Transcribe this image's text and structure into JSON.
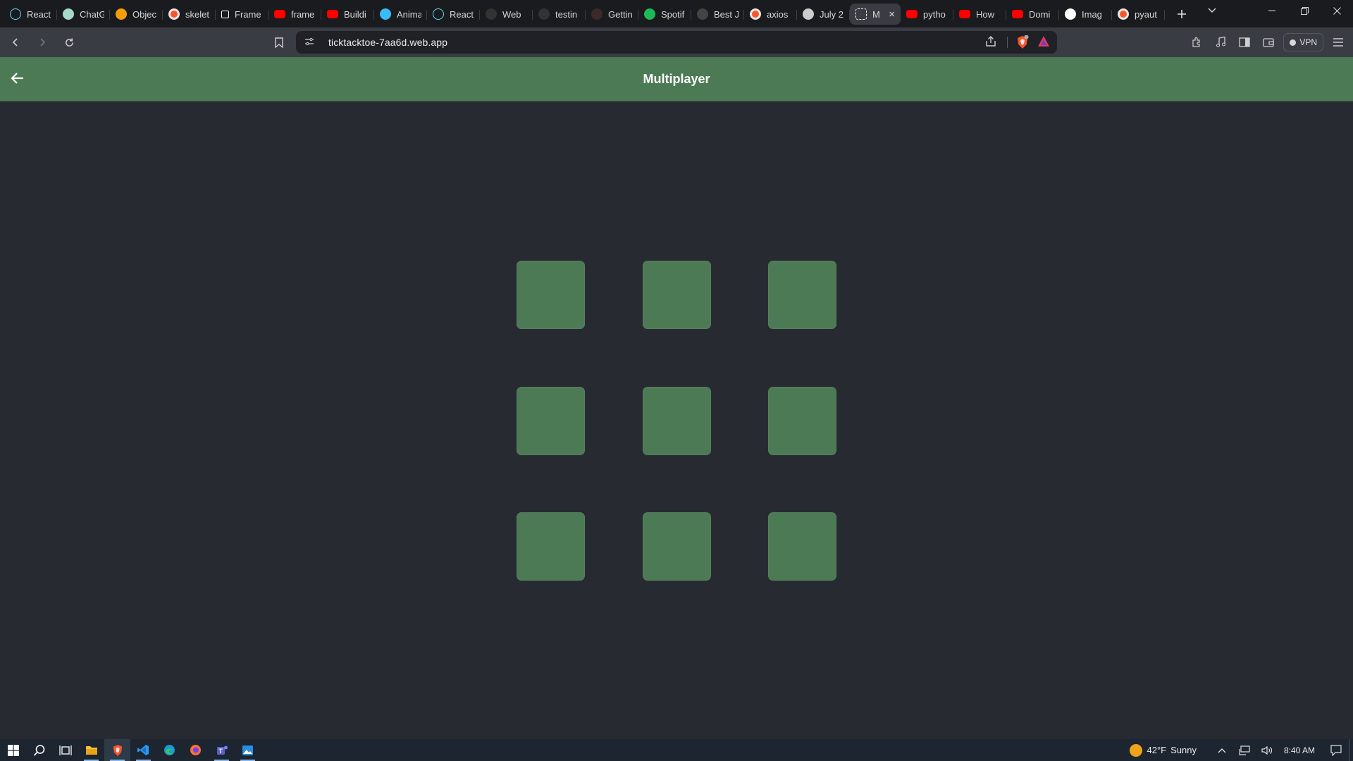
{
  "browser": {
    "tabs": [
      {
        "label": "React",
        "icon": "react-icon",
        "color": "#61dafb"
      },
      {
        "label": "ChatG",
        "icon": "chatgpt-icon",
        "color": "#a8d8c8"
      },
      {
        "label": "Objec",
        "icon": "pitchfork-icon",
        "color": "#f59e0b"
      },
      {
        "label": "skelet",
        "icon": "brave-search-icon",
        "color": "#e8e8e8"
      },
      {
        "label": "Frame",
        "icon": "framer-icon",
        "color": "#ffffff"
      },
      {
        "label": "frame",
        "icon": "youtube-icon",
        "color": "#ff0000"
      },
      {
        "label": "Buildi",
        "icon": "youtube-icon",
        "color": "#ff0000"
      },
      {
        "label": "Anima",
        "icon": "tailwind-icon",
        "color": "#38bdf8"
      },
      {
        "label": "React",
        "icon": "react-icon",
        "color": "#61dafb"
      },
      {
        "label": "Web",
        "icon": "dark-circle-icon",
        "color": "#333333"
      },
      {
        "label": "testin",
        "icon": "dark-circle-icon",
        "color": "#333333"
      },
      {
        "label": "Gettin",
        "icon": "dark-circle-icon",
        "color": "#3a2a2a"
      },
      {
        "label": "Spotif",
        "icon": "spotify-icon",
        "color": "#1db954"
      },
      {
        "label": "Best J",
        "icon": "js-icon",
        "color": "#444444"
      },
      {
        "label": "axios",
        "icon": "brave-search-icon",
        "color": "#e8e8e8"
      },
      {
        "label": "July 2",
        "icon": "globe-icon",
        "color": "#cccccc"
      },
      {
        "label": "M",
        "icon": "grid-icon",
        "color": "#ffffff",
        "active": true
      },
      {
        "label": "pytho",
        "icon": "youtube-icon",
        "color": "#ff0000"
      },
      {
        "label": "How",
        "icon": "youtube-icon",
        "color": "#ff0000"
      },
      {
        "label": "Domi",
        "icon": "youtube-icon",
        "color": "#ff0000"
      },
      {
        "label": "Imag",
        "icon": "github-icon",
        "color": "#ffffff"
      },
      {
        "label": "pyaut",
        "icon": "brave-search-icon",
        "color": "#e8e8e8"
      }
    ],
    "url": "ticktacktoe-7aa6d.web.app",
    "vpn_label": "VPN",
    "shield_count": "1"
  },
  "app": {
    "title": "Multiplayer",
    "accent_color": "#4c7a55",
    "background_color": "#282a32",
    "board": {
      "rows": 3,
      "cols": 3,
      "cells": [
        "",
        "",
        "",
        "",
        "",
        "",
        "",
        "",
        ""
      ]
    }
  },
  "taskbar": {
    "apps": [
      "windows-start-icon",
      "search-icon",
      "task-view-icon",
      "file-explorer-icon",
      "brave-icon",
      "vscode-icon",
      "edge-icon",
      "firefox-icon",
      "teams-icon",
      "photos-icon"
    ],
    "weather_temp": "42°F",
    "weather_text": "Sunny",
    "time": "8:40 AM"
  }
}
